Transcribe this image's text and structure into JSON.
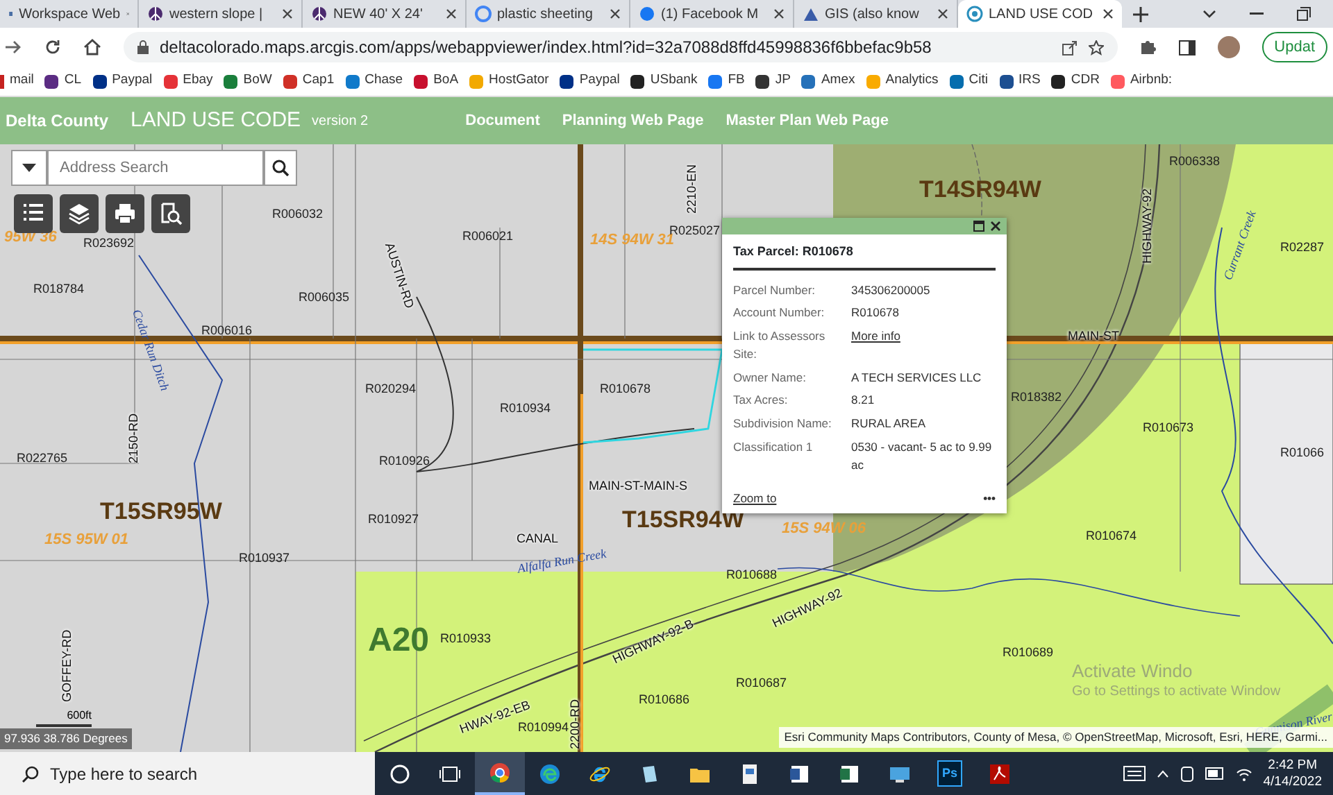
{
  "browser": {
    "tabs": [
      {
        "title": "Workspace Web",
        "selected": false,
        "kind": "doc"
      },
      {
        "title": "western slope |",
        "selected": false,
        "kind": "peace"
      },
      {
        "title": "NEW 40' X 24'",
        "selected": false,
        "kind": "peace"
      },
      {
        "title": "plastic sheeting",
        "selected": false,
        "kind": "google"
      },
      {
        "title": "(1) Facebook M",
        "selected": false,
        "kind": "facebook"
      },
      {
        "title": "GIS (also know",
        "selected": false,
        "kind": "mountain"
      },
      {
        "title": "LAND USE COD",
        "selected": true,
        "kind": "arcgis"
      }
    ],
    "address": "deltacolorado.maps.arcgis.com/apps/webappviewer/index.html?id=32a7088d8ffd45998836f6bbefac9b58",
    "update_button": "Updat",
    "bookmarks": [
      {
        "label": "mail",
        "color": "#c5221f"
      },
      {
        "label": "CL",
        "color": "#5b2c83"
      },
      {
        "label": "Paypal",
        "color": "#003087"
      },
      {
        "label": "Ebay",
        "color": "#e53238"
      },
      {
        "label": "BoW",
        "color": "#1a7f3c"
      },
      {
        "label": "Cap1",
        "color": "#d03027"
      },
      {
        "label": "Chase",
        "color": "#117aca"
      },
      {
        "label": "BoA",
        "color": "#c8102e"
      },
      {
        "label": "HostGator",
        "color": "#f2a900"
      },
      {
        "label": "Paypal",
        "color": "#003087"
      },
      {
        "label": "USbank",
        "color": "#222222"
      },
      {
        "label": "FB",
        "color": "#1877f2"
      },
      {
        "label": "JP",
        "color": "#333333"
      },
      {
        "label": "Amex",
        "color": "#2671b9"
      },
      {
        "label": "Analytics",
        "color": "#f9ab00"
      },
      {
        "label": "Citi",
        "color": "#056dae"
      },
      {
        "label": "IRS",
        "color": "#1d4f91"
      },
      {
        "label": "CDR",
        "color": "#222222"
      },
      {
        "label": "Airbnb:",
        "color": "#ff5a5f"
      }
    ]
  },
  "app_header": {
    "logo": "Delta County",
    "title": "LAND USE CODE",
    "version": "version 2",
    "links": [
      "Document",
      "Planning Web Page",
      "Master Plan Web Page"
    ]
  },
  "map": {
    "search": {
      "placeholder": "Address Search"
    },
    "labels": [
      {
        "text": "T14SR94W",
        "kind": "township"
      },
      {
        "text": "T15SR95W",
        "kind": "township"
      },
      {
        "text": "T15SR94W",
        "kind": "township"
      },
      {
        "text": "A20",
        "kind": "zone"
      },
      {
        "text": "95W 36",
        "kind": "section"
      },
      {
        "text": "14S 94W 31",
        "kind": "section"
      },
      {
        "text": "15S 95W 01",
        "kind": "section"
      },
      {
        "text": "15S 94W 06",
        "kind": "section"
      },
      {
        "text": "R006032",
        "kind": "parcel"
      },
      {
        "text": "R006021",
        "kind": "parcel"
      },
      {
        "text": "R025027",
        "kind": "parcel"
      },
      {
        "text": "R023692",
        "kind": "parcel"
      },
      {
        "text": "R018784",
        "kind": "parcel"
      },
      {
        "text": "R006035",
        "kind": "parcel"
      },
      {
        "text": "R006016",
        "kind": "parcel"
      },
      {
        "text": "R020294",
        "kind": "parcel"
      },
      {
        "text": "R010934",
        "kind": "parcel"
      },
      {
        "text": "R010678",
        "kind": "parcel"
      },
      {
        "text": "R022765",
        "kind": "parcel"
      },
      {
        "text": "R010926",
        "kind": "parcel"
      },
      {
        "text": "R010927",
        "kind": "parcel"
      },
      {
        "text": "R010937",
        "kind": "parcel"
      },
      {
        "text": "R010933",
        "kind": "parcel"
      },
      {
        "text": "R010688",
        "kind": "parcel"
      },
      {
        "text": "R010686",
        "kind": "parcel"
      },
      {
        "text": "R010687",
        "kind": "parcel"
      },
      {
        "text": "R010994",
        "kind": "parcel"
      },
      {
        "text": "R010689",
        "kind": "parcel"
      },
      {
        "text": "R010674",
        "kind": "parcel"
      },
      {
        "text": "R010673",
        "kind": "parcel"
      },
      {
        "text": "R018382",
        "kind": "parcel"
      },
      {
        "text": "R006338",
        "kind": "parcel"
      },
      {
        "text": "R02287",
        "kind": "parcel"
      },
      {
        "text": "R01066",
        "kind": "parcel"
      },
      {
        "text": "MAIN-ST",
        "kind": "road"
      },
      {
        "text": "HIGHWAY-92",
        "kind": "road"
      },
      {
        "text": "MAIN-ST-MAIN-S",
        "kind": "road"
      },
      {
        "text": "CANAL",
        "kind": "road"
      },
      {
        "text": "HIGHWAY-92",
        "kind": "road"
      },
      {
        "text": "AUSTIN-RD",
        "kind": "road"
      },
      {
        "text": "2150-RD",
        "kind": "road"
      },
      {
        "text": "GOFFEY-RD",
        "kind": "road"
      },
      {
        "text": "2200-RD",
        "kind": "road"
      },
      {
        "text": "2210-EN",
        "kind": "road"
      },
      {
        "text": "HWAY-92-EB",
        "kind": "road"
      },
      {
        "text": "HIGHWAY-92-B",
        "kind": "road"
      },
      {
        "text": "Cedar Run Ditch",
        "kind": "water"
      },
      {
        "text": "Alfalfa Run Creek",
        "kind": "water"
      },
      {
        "text": "Currant Creek",
        "kind": "water"
      },
      {
        "text": "Gunnison River",
        "kind": "water"
      }
    ],
    "popup": {
      "title": "Tax Parcel: R010678",
      "fields": [
        {
          "label": "Parcel Number:",
          "value": "345306200005",
          "kind": "text"
        },
        {
          "label": "Account Number:",
          "value": "R010678",
          "kind": "text"
        },
        {
          "label": "Link to Assessors Site:",
          "value": "More info",
          "kind": "link"
        },
        {
          "label": "Owner Name:",
          "value": "A TECH SERVICES LLC",
          "kind": "text"
        },
        {
          "label": "Tax Acres:",
          "value": "8.21",
          "kind": "text"
        },
        {
          "label": "Subdivision Name:",
          "value": "RURAL AREA",
          "kind": "text"
        },
        {
          "label": "Classification 1",
          "value": "0530 - vacant- 5 ac to 9.99 ac",
          "kind": "text"
        }
      ],
      "zoom_link": "Zoom to",
      "more": "•••"
    },
    "coordinates": "97.936 38.786 Degrees",
    "scale": "600ft",
    "attribution": "Esri Community Maps Contributors, County of Mesa, © OpenStreetMap, Microsoft, Esri, HERE, Garmi..."
  },
  "os_notice": [
    "Activate Windo",
    "Go to Settings to activate Window"
  ],
  "taskbar": {
    "search_placeholder": "Type here to search",
    "apps": [
      {
        "kind": "cortana",
        "selected": false
      },
      {
        "kind": "taskview",
        "selected": false
      },
      {
        "kind": "chrome",
        "selected": true
      },
      {
        "kind": "edge",
        "selected": false
      },
      {
        "kind": "ie",
        "selected": false
      },
      {
        "kind": "notepad",
        "selected": false
      },
      {
        "kind": "folder",
        "selected": false
      },
      {
        "kind": "document",
        "selected": false
      },
      {
        "kind": "word",
        "selected": false
      },
      {
        "kind": "excel",
        "selected": false
      },
      {
        "kind": "monitor",
        "selected": false
      },
      {
        "kind": "photoshop",
        "selected": false,
        "label": "Ps"
      },
      {
        "kind": "acrobat",
        "selected": false
      }
    ],
    "time": "2:42 PM",
    "date": "4/14/2022"
  }
}
